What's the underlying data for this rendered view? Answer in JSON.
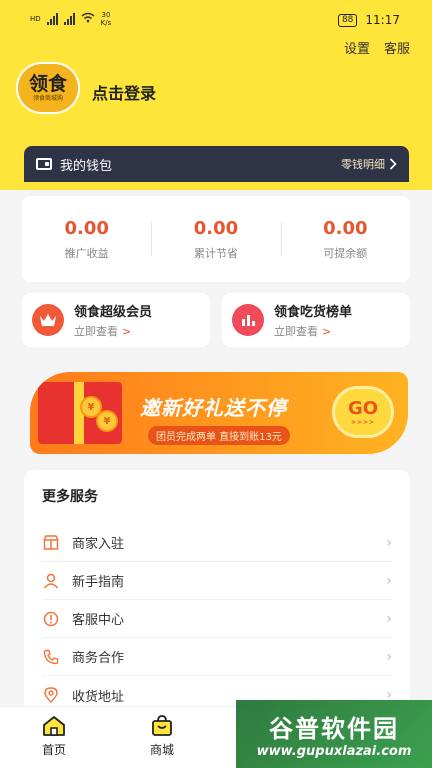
{
  "status_bar": {
    "signal1": "HD",
    "net_speed_value": "30",
    "net_speed_unit": "K/s",
    "battery": "88",
    "time": "11:17"
  },
  "header": {
    "settings": "设置",
    "service": "客服",
    "logo_main": "领食",
    "logo_sub": "领食商城购",
    "login": "点击登录"
  },
  "wallet": {
    "title": "我的钱包",
    "link": "零钱明细"
  },
  "stats": [
    {
      "value": "0.00",
      "label": "推广收益"
    },
    {
      "value": "0.00",
      "label": "累计节省"
    },
    {
      "value": "0.00",
      "label": "可提余额"
    }
  ],
  "promos": [
    {
      "title": "领食超级会员",
      "sub": "立即查看",
      "arrow": ">",
      "color": "#f05a3a"
    },
    {
      "title": "领食吃货榜单",
      "sub": "立即查看",
      "arrow": ">",
      "color": "#ef4b5a"
    }
  ],
  "banner": {
    "headline": "邀新好礼送不停",
    "sub": "团员完成两单 直接到账13元",
    "go": "GO",
    "go_arrows": ">>>>"
  },
  "services": {
    "title": "更多服务",
    "items": [
      {
        "label": "商家入驻",
        "icon": "store-icon"
      },
      {
        "label": "新手指南",
        "icon": "user-icon"
      },
      {
        "label": "客服中心",
        "icon": "info-icon"
      },
      {
        "label": "商务合作",
        "icon": "phone-icon"
      },
      {
        "label": "收货地址",
        "icon": "location-icon"
      }
    ]
  },
  "nav": {
    "home": "首页",
    "mall": "商城"
  },
  "watermark": {
    "main": "谷普软件园",
    "url": "www.gupuxlazai.com"
  },
  "colors": {
    "brand_yellow": "#ffe43a",
    "accent_orange": "#e8552e",
    "wallet_dark": "#2f3346"
  }
}
